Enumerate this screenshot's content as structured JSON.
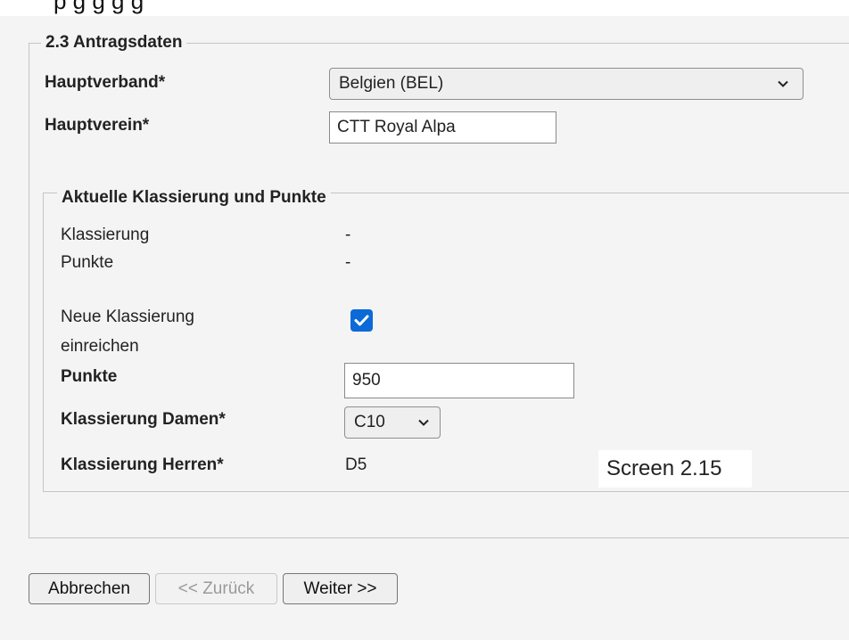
{
  "top_cut_text": "p   g  g  g   g",
  "section": {
    "legend": "2.3 Antragsdaten",
    "hauptverband_label": "Hauptverband*",
    "hauptverband_value": "Belgien (BEL)",
    "hauptverein_label": "Hauptverein*",
    "hauptverein_value": "CTT Royal Alpa"
  },
  "classification": {
    "legend": "Aktuelle Klassierung und Punkte",
    "klassierung_label": "Klassierung",
    "klassierung_value": "-",
    "punkte_label": "Punkte",
    "punkte_value": "-",
    "neue_label_line1": "Neue Klassierung",
    "neue_label_line2": "einreichen",
    "neue_checked": true,
    "punkte_input_label": "Punkte",
    "punkte_input_value": "950",
    "damen_label": "Klassierung Damen*",
    "damen_value": "C10",
    "herren_label": "Klassierung Herren*",
    "herren_value": "D5"
  },
  "screen_label": "Screen 2.15",
  "buttons": {
    "cancel": "Abbrechen",
    "back": "<< Zurück",
    "next": "Weiter >>"
  },
  "colors": {
    "checkbox_accent": "#0b6ad8",
    "page_background": "#f4f4f4"
  }
}
